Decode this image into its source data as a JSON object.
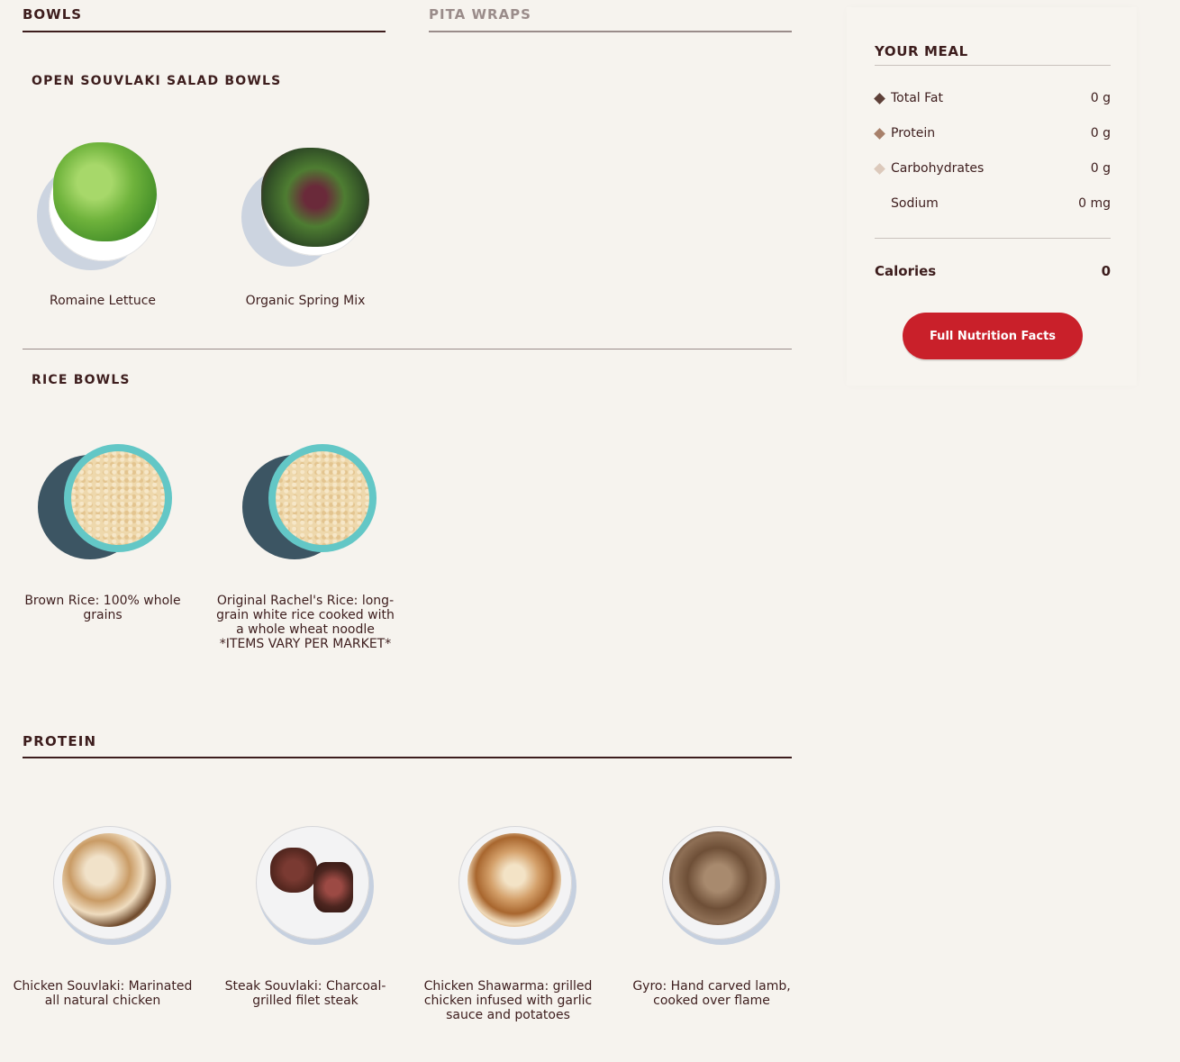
{
  "tabs": {
    "bowls": "BOWLS",
    "pita_wraps": "PITA WRAPS"
  },
  "sections": {
    "salad_bowls": {
      "heading": "OPEN SOUVLAKI SALAD BOWLS",
      "items": [
        {
          "label": "Romaine Lettuce"
        },
        {
          "label": "Organic Spring Mix"
        }
      ]
    },
    "rice_bowls": {
      "heading": "RICE BOWLS",
      "items": [
        {
          "label": "Brown Rice: 100% whole grains"
        },
        {
          "label": "Original Rachel's Rice: long-grain white rice cooked with a whole wheat noodle *ITEMS VARY PER MARKET*"
        }
      ]
    },
    "protein": {
      "heading": "PROTEIN",
      "items": [
        {
          "label": "Chicken Souvlaki: Marinated all natural chicken"
        },
        {
          "label": "Steak Souvlaki: Charcoal-grilled filet steak"
        },
        {
          "label": "Chicken Shawarma: grilled chicken infused with garlic sauce and potatoes"
        },
        {
          "label": "Gyro: Hand carved lamb, cooked over flame"
        }
      ]
    }
  },
  "sidebar": {
    "title": "YOUR MEAL",
    "nutrients": [
      {
        "name": "Total Fat",
        "value": "0 g",
        "color": "#5e4038"
      },
      {
        "name": "Protein",
        "value": "0 g",
        "color": "#a8806a"
      },
      {
        "name": "Carbohydrates",
        "value": "0 g",
        "color": "#dcc9bb"
      },
      {
        "name": "Sodium",
        "value": "0 mg"
      }
    ],
    "calories_label": "Calories",
    "calories_value": "0",
    "button_label": "Full Nutrition Facts"
  },
  "colors": {
    "background": "#f6f3ee",
    "text": "#3d1d1d",
    "muted": "#9a8c8a",
    "button": "#c9202a"
  }
}
